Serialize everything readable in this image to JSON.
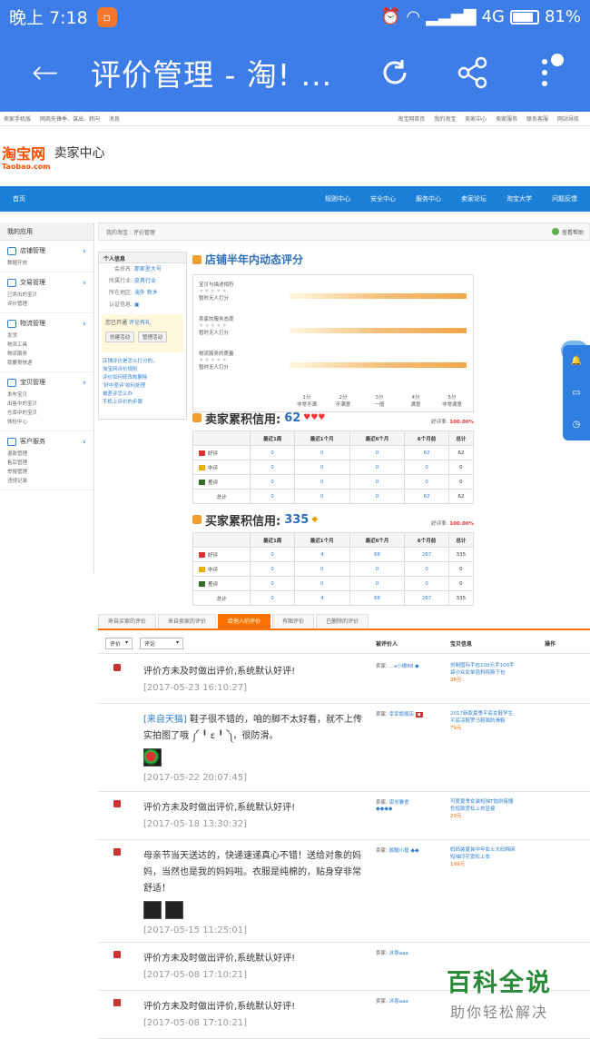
{
  "status_bar": {
    "time": "晚上 7:18",
    "network": "4G",
    "battery": "81%"
  },
  "toolbar": {
    "title": "评价管理 - 淘! ..."
  },
  "top_links": {
    "left": [
      "卖家手机版",
      "网商先锋季、谋出、转向",
      "消息"
    ],
    "right": [
      "淘宝网首页",
      "我的淘宝",
      "卖家中心",
      "卖家服务",
      "联系客服",
      "网站导航"
    ]
  },
  "brand": {
    "logo_cn": "淘宝网",
    "logo_en": "Taobao.com",
    "section": "卖家中心"
  },
  "nav": {
    "home": "首页",
    "items": [
      "规则中心",
      "安全中心",
      "服务中心",
      "卖家论坛",
      "淘宝大学",
      "问题反馈"
    ]
  },
  "sidebar": {
    "title": "我的应用",
    "groups": [
      {
        "title": "店铺管理",
        "links": [
          "数据开放"
        ]
      },
      {
        "title": "交易管理",
        "links": [
          "已卖出的宝贝",
          "评价管理"
        ]
      },
      {
        "title": "物流管理",
        "links": [
          "发货",
          "物流工具",
          "物流服务",
          "我要寄快递"
        ]
      },
      {
        "title": "宝贝管理",
        "links": [
          "发布宝贝",
          "出售中的宝贝",
          "仓库中的宝贝",
          "体检中心"
        ]
      },
      {
        "title": "客户服务",
        "links": [
          "退款管理",
          "售后管理",
          "举报管理",
          "违规记录"
        ]
      }
    ]
  },
  "breadcrumb": {
    "text": "我的淘宝 : 评价管理",
    "help": "查看帮助"
  },
  "info_card": {
    "title": "个人信息",
    "rows": [
      {
        "k": "会员名:",
        "v": "那家里大号"
      },
      {
        "k": "所属行业:",
        "v": "皮具行业"
      },
      {
        "k": "所在地区:",
        "v": "海外 新乡"
      },
      {
        "k": "认证信息:",
        "v": ""
      }
    ],
    "activity_text": "您已开通",
    "activity_link": "评论有礼",
    "buttons": [
      "创建活动",
      "管理活动"
    ],
    "links": [
      "店铺评价是怎么打分的。",
      "淘宝网评价规则",
      "评价如何修改和删除",
      "'好中差评'如何处理",
      "被差评怎么办",
      "手机上评价的步骤"
    ]
  },
  "dsr": {
    "title": "店铺半年内动态评分",
    "items": [
      {
        "label": "宝贝与描述相符",
        "note": "暂时无人打分"
      },
      {
        "label": "卖家的服务态度",
        "note": "暂时无人打分"
      },
      {
        "label": "物流服务的质量",
        "note": "暂时无人打分"
      }
    ],
    "scale": [
      {
        "top": "1分",
        "bottom": "非常不满"
      },
      {
        "top": "2分",
        "bottom": "不满意"
      },
      {
        "top": "3分",
        "bottom": "一般"
      },
      {
        "top": "4分",
        "bottom": "满意"
      },
      {
        "top": "5分",
        "bottom": "非常满意"
      }
    ]
  },
  "seller_credit": {
    "title": "卖家累积信用:",
    "score": "62",
    "rate_label": "好评率:",
    "rate": "100.00%",
    "headers": [
      "",
      "最近1周",
      "最近1个月",
      "最近6个月",
      "6个月前",
      "总计"
    ],
    "rows": [
      {
        "label": "好评",
        "values": [
          "0",
          "0",
          "0",
          "62",
          "62"
        ]
      },
      {
        "label": "中评",
        "values": [
          "0",
          "0",
          "0",
          "0",
          "0"
        ]
      },
      {
        "label": "差评",
        "values": [
          "0",
          "0",
          "0",
          "0",
          "0"
        ]
      },
      {
        "label": "总计",
        "values": [
          "0",
          "0",
          "0",
          "62",
          "62"
        ]
      }
    ]
  },
  "buyer_credit": {
    "title": "买家累积信用:",
    "score": "335",
    "rate_label": "好评率:",
    "rate": "100.00%",
    "headers": [
      "",
      "最近1周",
      "最近1个月",
      "最近6个月",
      "6个月前",
      "总计"
    ],
    "rows": [
      {
        "label": "好评",
        "values": [
          "0",
          "4",
          "68",
          "267",
          "335"
        ]
      },
      {
        "label": "中评",
        "values": [
          "0",
          "0",
          "0",
          "0",
          "0"
        ]
      },
      {
        "label": "差评",
        "values": [
          "0",
          "0",
          "0",
          "0",
          "0"
        ]
      },
      {
        "label": "总计",
        "values": [
          "0",
          "4",
          "68",
          "267",
          "335"
        ]
      }
    ]
  },
  "tabs": [
    "来自买家的评价",
    "来自卖家的评价",
    "给他人的评价",
    "有图评价",
    "已删除的评价"
  ],
  "filters": {
    "rating": "评价",
    "content": "评论",
    "col_rated": "被评价人",
    "col_goods": "宝贝信息",
    "col_ops": "操作"
  },
  "reviews": [
    {
      "text": "评价方未及时做出评价,系统默认好评!",
      "time": "[2017-05-23 16:10:27]",
      "buyer_label": "卖家:",
      "buyer": "...a小楼88",
      "goods": "创制国际手包100元手100手袋小众女单肩斜挎腋下包",
      "price": "28元"
    },
    {
      "tag": "[来自天猫]",
      "text": "鞋子很不错的，咱的脚不太好看，就不上传实拍图了哦 ༼ ╹ ε ╹ ༽，很防滑。",
      "time": "[2017-05-22 20:07:45]",
      "buyer_label": "卖家:",
      "buyer": "幸幸旗舰店",
      "goods": "2017新款夏季平底女鞋学生平底凉鞋罗马鞋面防滑鞋",
      "price": "79元"
    },
    {
      "text": "评价方未及时做出评价,系统默认好评!",
      "time": "[2017-05-18 13:30:32]",
      "buyer_label": "卖家:",
      "buyer": "南邻雅舍",
      "goods": "可爱夏季女装短袖T恤拼接撞色短款宽松上衣显瘦",
      "price": "29元"
    },
    {
      "text": "母亲节当天送达的，快递速递真心不错！送给对象的妈妈，当然也是我的妈妈啦。衣服是纯棉的，贴身穿非常舒适！",
      "time": "[2017-05-15 11:25:01]",
      "buyer_label": "卖家:",
      "buyer": "贩酷小屋",
      "goods": "妈妈装夏装中年女士大码棉麻短袖印花宽松上衣",
      "price": "199元"
    },
    {
      "text": "评价方未及时做出评价,系统默认好评!",
      "time": "[2017-05-08 17:10:21]",
      "buyer_label": "卖家:",
      "buyer": "沐恩aaa",
      "goods": "",
      "price": ""
    },
    {
      "text": "评价方未及时做出评价,系统默认好评!",
      "time": "[2017-05-08 17:10:21]",
      "buyer_label": "卖家:",
      "buyer": "沐恩aaa",
      "goods": "",
      "price": ""
    }
  ],
  "watermark": {
    "title": "百科全说",
    "subtitle": "助你轻松解决"
  }
}
